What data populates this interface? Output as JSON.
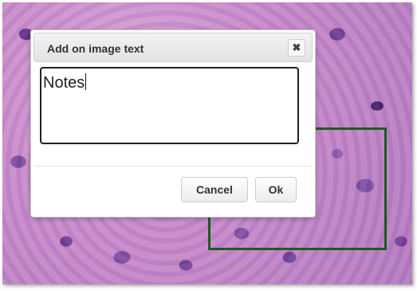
{
  "dialog": {
    "title": "Add on image text",
    "close_symbol": "✖",
    "text_value": "Notes",
    "cancel_label": "Cancel",
    "ok_label": "Ok"
  },
  "icons": {
    "close": "close-icon"
  },
  "colors": {
    "annotation_border": "#1e5a1e",
    "tissue_base": "#c88ccb"
  }
}
